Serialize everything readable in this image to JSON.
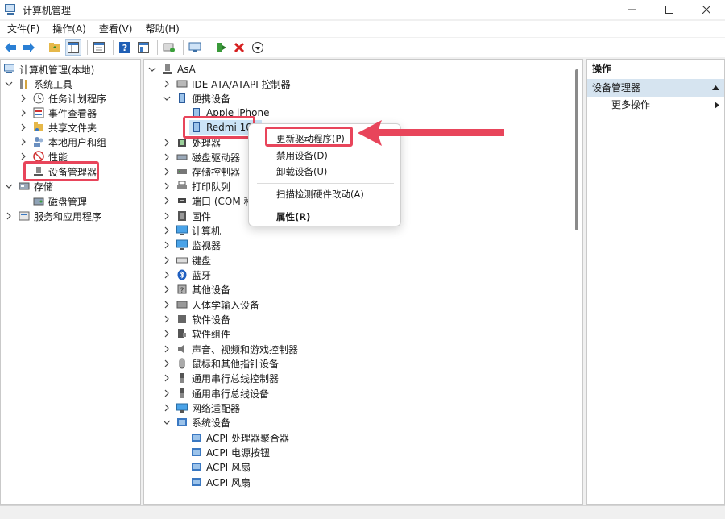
{
  "window": {
    "title": "计算机管理",
    "controls": [
      "minimize",
      "maximize",
      "close"
    ]
  },
  "menubar": {
    "items": [
      {
        "label": "文件(F)"
      },
      {
        "label": "操作(A)"
      },
      {
        "label": "查看(V)"
      },
      {
        "label": "帮助(H)"
      }
    ]
  },
  "toolbar": {
    "icons": [
      "back-arrow-icon",
      "forward-arrow-icon",
      "up-folder-icon",
      "show-hide-tree-icon",
      "properties-icon",
      "help-icon",
      "help-topics-icon",
      "scan-hardware-icon",
      "monitor-icon",
      "update-driver-icon",
      "uninstall-icon",
      "download-icon"
    ]
  },
  "left_tree": {
    "root": "计算机管理(本地)",
    "items": [
      {
        "label": "系统工具"
      },
      {
        "label": "任务计划程序"
      },
      {
        "label": "事件查看器"
      },
      {
        "label": "共享文件夹"
      },
      {
        "label": "本地用户和组"
      },
      {
        "label": "性能"
      },
      {
        "label": "设备管理器"
      },
      {
        "label": "存储"
      },
      {
        "label": "磁盘管理"
      },
      {
        "label": "服务和应用程序"
      }
    ]
  },
  "device_tree": {
    "root": "AsA",
    "items": [
      {
        "label": "IDE ATA/ATAPI 控制器"
      },
      {
        "label": "便携设备"
      },
      {
        "label": "Apple iPhone"
      },
      {
        "label": "Redmi 10X"
      },
      {
        "label": "处理器"
      },
      {
        "label": "磁盘驱动器"
      },
      {
        "label": "存储控制器"
      },
      {
        "label": "打印队列"
      },
      {
        "label": "端口 (COM 和"
      },
      {
        "label": "固件"
      },
      {
        "label": "计算机"
      },
      {
        "label": "监视器"
      },
      {
        "label": "键盘"
      },
      {
        "label": "蓝牙"
      },
      {
        "label": "其他设备"
      },
      {
        "label": "人体学输入设备"
      },
      {
        "label": "软件设备"
      },
      {
        "label": "软件组件"
      },
      {
        "label": "声音、视频和游戏控制器"
      },
      {
        "label": "鼠标和其他指针设备"
      },
      {
        "label": "通用串行总线控制器"
      },
      {
        "label": "通用串行总线设备"
      },
      {
        "label": "网络适配器"
      },
      {
        "label": "系统设备"
      },
      {
        "label": "ACPI 处理器聚合器"
      },
      {
        "label": "ACPI 电源按钮"
      },
      {
        "label": "ACPI 风扇"
      },
      {
        "label": "ACPI 风扇"
      }
    ]
  },
  "context_menu": {
    "items": [
      {
        "label": "更新驱动程序(P)"
      },
      {
        "label": "禁用设备(D)"
      },
      {
        "label": "卸载设备(U)"
      },
      {
        "label": "扫描检测硬件改动(A)"
      },
      {
        "label": "属性(R)"
      }
    ]
  },
  "actions_pane": {
    "header": "操作",
    "section": "设备管理器",
    "more": "更多操作"
  },
  "colors": {
    "highlight": "#e8455b",
    "selection": "#cce4f7",
    "section_bg": "#d6e4f0"
  }
}
